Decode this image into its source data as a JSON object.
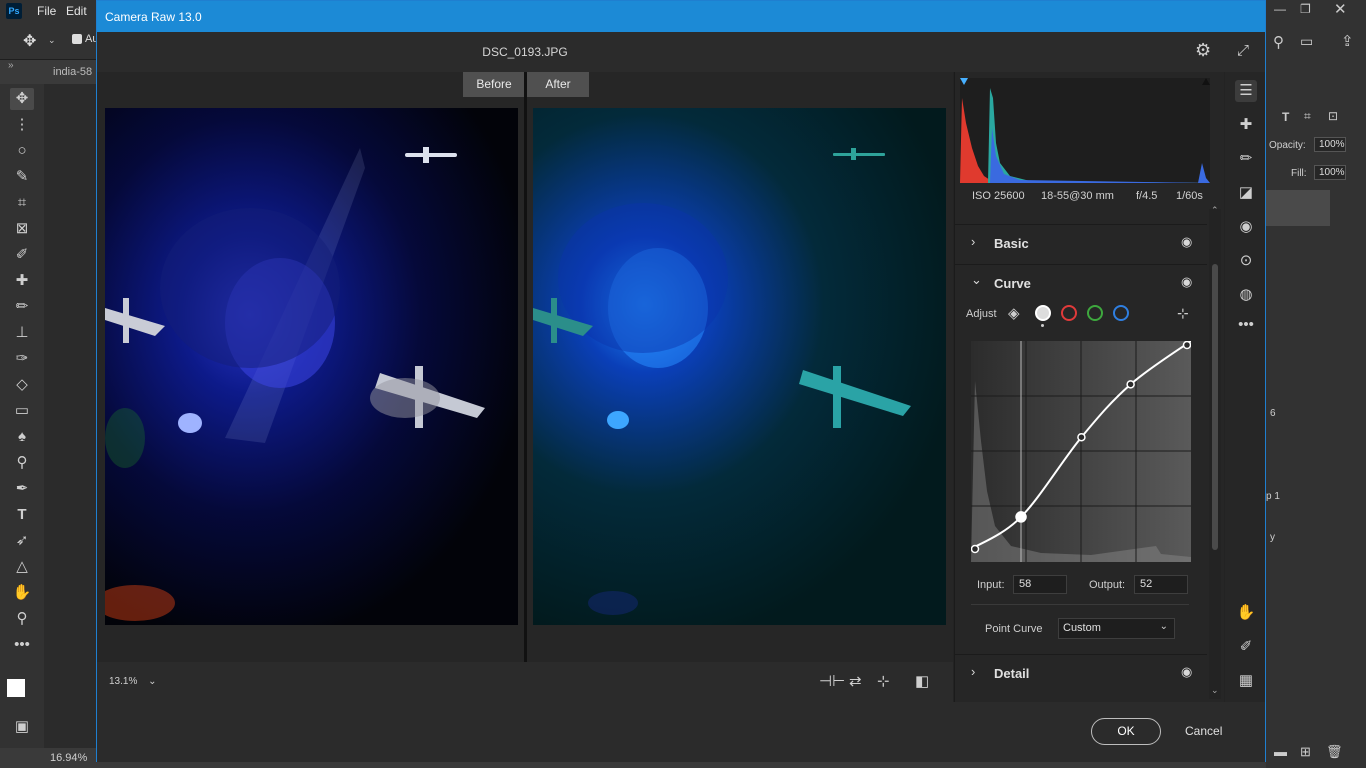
{
  "photoshop": {
    "logo": "Ps",
    "menu": [
      "File",
      "Edit"
    ],
    "option_partial": "Au",
    "doc_tab": "india-58",
    "zoom_status": "16.94%",
    "right_panel": {
      "opacity_label": "Opacity:",
      "opacity_value": "100%",
      "fill_label": "Fill:",
      "fill_value": "100%",
      "fragments": [
        "6",
        "p 1",
        "y"
      ]
    }
  },
  "dialog": {
    "title": "Camera Raw 13.0",
    "filename": "DSC_0193.JPG",
    "before_label": "Before",
    "after_label": "After",
    "zoom_level": "13.1%",
    "ok_label": "OK",
    "cancel_label": "Cancel"
  },
  "exif": {
    "iso": "ISO 25600",
    "lens": "18-55@30 mm",
    "aperture": "f/4.5",
    "shutter": "1/60s"
  },
  "sections": {
    "basic": "Basic",
    "curve": "Curve",
    "detail": "Detail"
  },
  "curve": {
    "adjust_label": "Adjust",
    "input_label": "Input:",
    "input_value": "58",
    "output_label": "Output:",
    "output_value": "52",
    "point_curve_label": "Point Curve",
    "point_curve_value": "Custom",
    "points": [
      [
        0,
        15
      ],
      [
        58,
        52
      ],
      [
        128,
        144
      ],
      [
        185,
        205
      ],
      [
        255,
        255
      ]
    ],
    "channel_colors": [
      "#dddddd",
      "#e03a3a",
      "#3ea83e",
      "#2f7fe0"
    ]
  },
  "icons": {
    "gear": "⚙",
    "expand": "⤢",
    "chevron_right": "›",
    "chevron_down": "⌄",
    "eye": "◉"
  }
}
